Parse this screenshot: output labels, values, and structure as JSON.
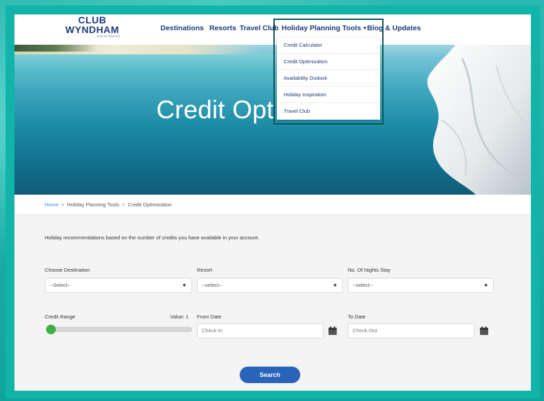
{
  "logo": {
    "line1": "CLUB",
    "line2": "WYNDHAM",
    "line3": "SOUTH PACIFIC"
  },
  "nav": {
    "destinations": "Destinations",
    "resorts": "Resorts",
    "travel_club": "Travel Club",
    "holiday_planning_tools": "Holiday Planning Tools",
    "blog_updates": "Blog & Updates"
  },
  "dropdown": {
    "items": [
      "Credit Calculator",
      "Credit Optimization",
      "Availability Outlook",
      "Holiday Inspiration",
      "Travel Club"
    ]
  },
  "hero": {
    "title": "Credit Opt"
  },
  "breadcrumb": {
    "home": "Home",
    "section": "Holiday Planning Tools",
    "current": "Credit Optimization"
  },
  "form": {
    "intro": "Holiday recommendations based on the number of credits you have available in your account.",
    "destination_label": "Choose Destination",
    "destination_value": "--Select--",
    "resort_label": "Resort",
    "resort_value": "--select--",
    "nights_label": "No. Of Nights Stay",
    "nights_value": "--select--",
    "credit_range_label": "Credit Range",
    "credit_range_value": "Value: 1",
    "credit_range_level": 0,
    "from_date_label": "From Date",
    "from_date_placeholder": "Check-In",
    "to_date_label": "To Date",
    "to_date_placeholder": "Check-Out",
    "search_label": "Search"
  },
  "colors": {
    "frame": "#12b3a9",
    "brand_navy": "#1c3a78",
    "button_blue": "#2a64b8",
    "slider_green": "#3cb043",
    "dropdown_outline": "#0d5552"
  },
  "icons": {
    "calendar": "calendar-icon",
    "caret": "caret-down-icon",
    "select_arrow": "select-arrows-icon"
  }
}
